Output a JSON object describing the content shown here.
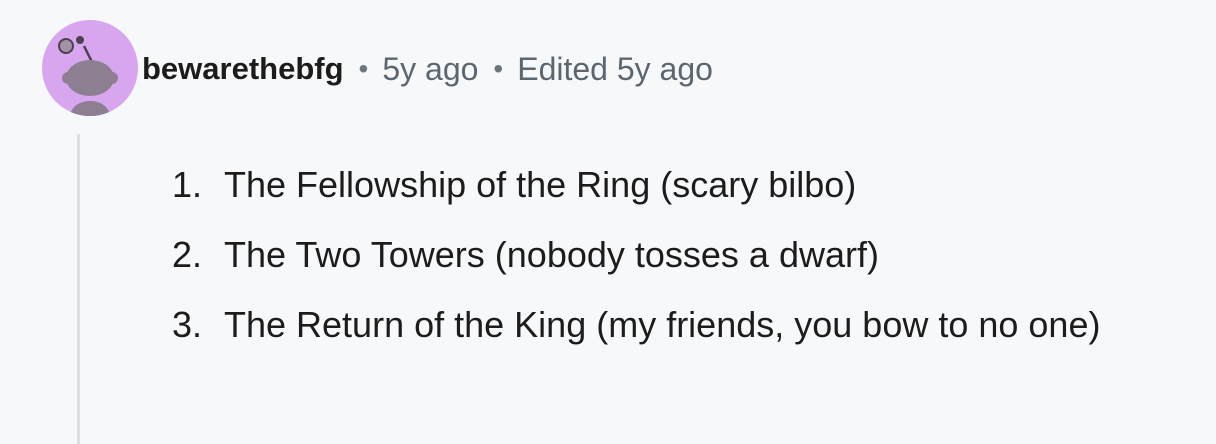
{
  "comment": {
    "username": "bewarethebfg",
    "separator": "•",
    "posted": "5y ago",
    "edited": "Edited 5y ago",
    "avatar_color": "#d8a6ee",
    "avatar_icon": "reddit-snoo-icon",
    "list": [
      {
        "number": "1.",
        "text": "The Fellowship of the Ring (scary bilbo)"
      },
      {
        "number": "2.",
        "text": "The Two Towers (nobody tosses a dwarf)"
      },
      {
        "number": "3.",
        "text": "The Return of the King (my friends, you bow to no one)"
      }
    ]
  }
}
